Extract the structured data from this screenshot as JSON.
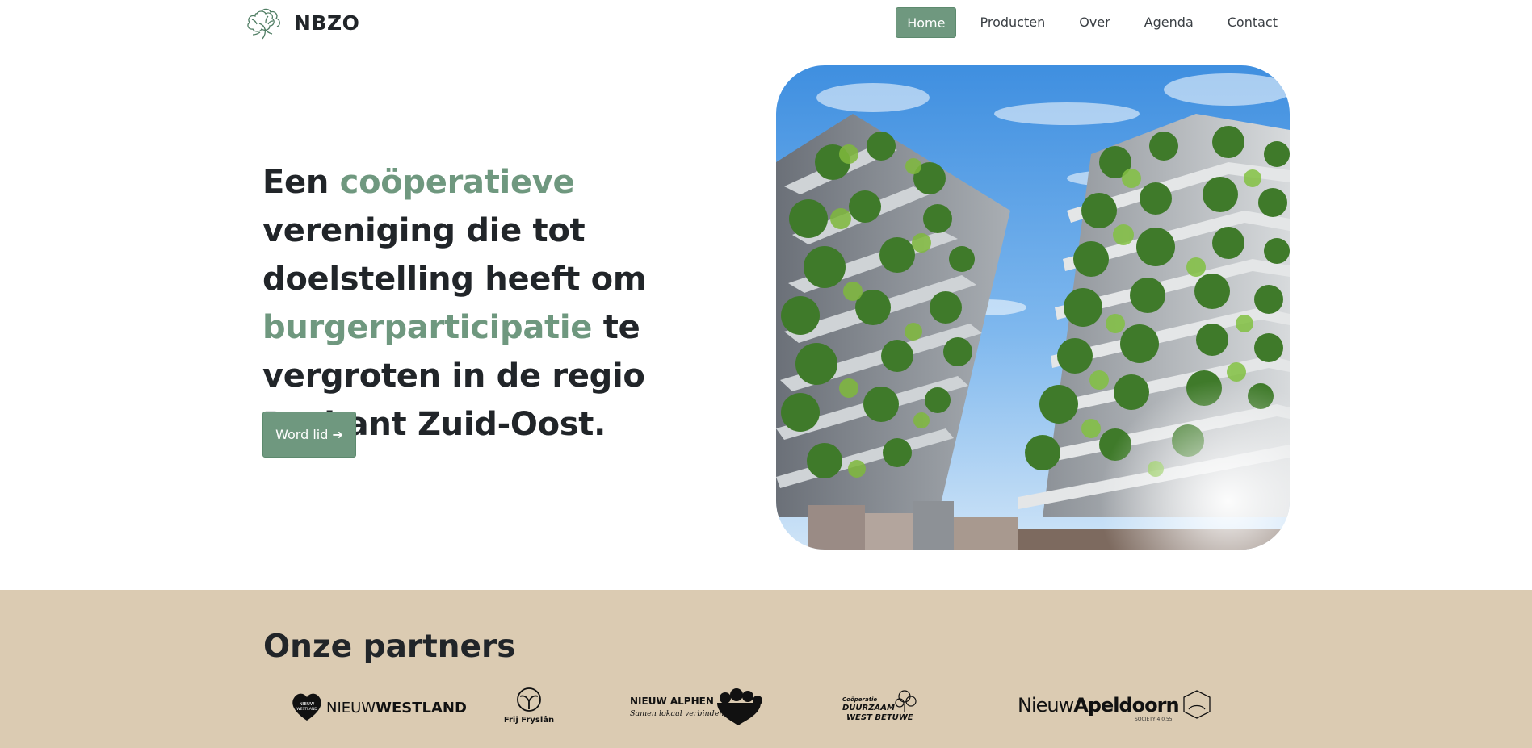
{
  "brand": {
    "name": "NBZO",
    "logo_icon": "tree-logo-icon"
  },
  "nav": {
    "items": [
      {
        "label": "Home",
        "active": true
      },
      {
        "label": "Producten",
        "active": false
      },
      {
        "label": "Over",
        "active": false
      },
      {
        "label": "Agenda",
        "active": false
      },
      {
        "label": "Contact",
        "active": false
      }
    ]
  },
  "hero": {
    "title_parts": {
      "p1": "Een ",
      "a1": "coöperatieve",
      "p2": " vereniging die tot doelstelling heeft om ",
      "a2": "burgerparticipatie",
      "p3": " te vergroten in de regio Brabant Zuid-Oost."
    },
    "cta_label": "Word lid ➔",
    "image_icon": "vertical-forest-photo"
  },
  "partners": {
    "title": "Onze partners",
    "logos": [
      {
        "name": "nieuw-westland",
        "text_a": "NIEUW",
        "text_b": "WESTLAND",
        "badge_a": "NIEUW",
        "badge_b": "WESTLAND"
      },
      {
        "name": "frij-fryslan",
        "text": "Frij Fryslân"
      },
      {
        "name": "nieuw-alphen",
        "text_a": "NIEUW ALPHEN",
        "text_b": "Samen lokaal verbinden"
      },
      {
        "name": "duurzaam-west-betuwe",
        "text_a": "Coöperatie",
        "text_b": "DUURZAAM",
        "text_c": "WEST BETUWE"
      },
      {
        "name": "nieuw-apeldoorn",
        "text_a": "Nieuw",
        "text_b": "Apeldoorn",
        "text_c": "SOCIETY 4.0.55"
      }
    ]
  },
  "colors": {
    "accent": "#6f987f",
    "partners_bg": "#dbcbb2",
    "text": "#212529"
  }
}
